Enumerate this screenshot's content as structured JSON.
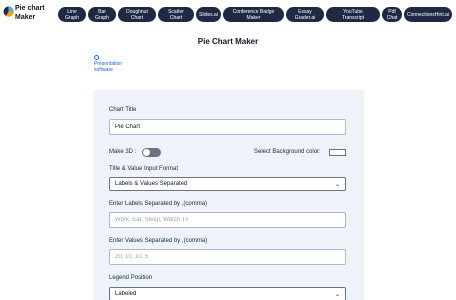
{
  "brand": {
    "line1": "Pie chart",
    "line2": "Maker"
  },
  "nav": [
    {
      "line1": "Line",
      "line2": "Graph"
    },
    {
      "line1": "Bar",
      "line2": "Graph"
    },
    {
      "line1": "Doughnut",
      "line2": "Chart"
    },
    {
      "line1": "Scatter",
      "line2": "Chart"
    },
    {
      "line1": "Slides.ai",
      "line2": ""
    },
    {
      "line1": "Conference Badge",
      "line2": "Maker"
    },
    {
      "line1": "Essay",
      "line2": "Grader.ai"
    },
    {
      "line1": "YouTube",
      "line2": "Transcript"
    },
    {
      "line1": "Pdf",
      "line2": "Chat"
    },
    {
      "line1": "ConnectionsHint.ai",
      "line2": ""
    }
  ],
  "page_title": "Pie Chart Maker",
  "ad": {
    "line1": "Presentation",
    "line2": "software"
  },
  "form": {
    "chart_title_label": "Chart Title",
    "chart_title_value": "Pie Chart",
    "make3d_label": "Make 3D :",
    "bg_color_label": "Select Background color:",
    "bg_color_value": "#ffffff",
    "format_label": "Title & Value Input Format",
    "format_value": "Labels & Values Separated",
    "labels_label": "Enter Labels Separated by ,(comma)",
    "labels_placeholder": "Work, Eat, Sleep, Watch Tv",
    "values_label": "Enter Values Separated by ,(comma)",
    "values_placeholder": "20, 10, 10, 5",
    "legend_label": "Legend Position",
    "legend_value": "Labeled"
  }
}
